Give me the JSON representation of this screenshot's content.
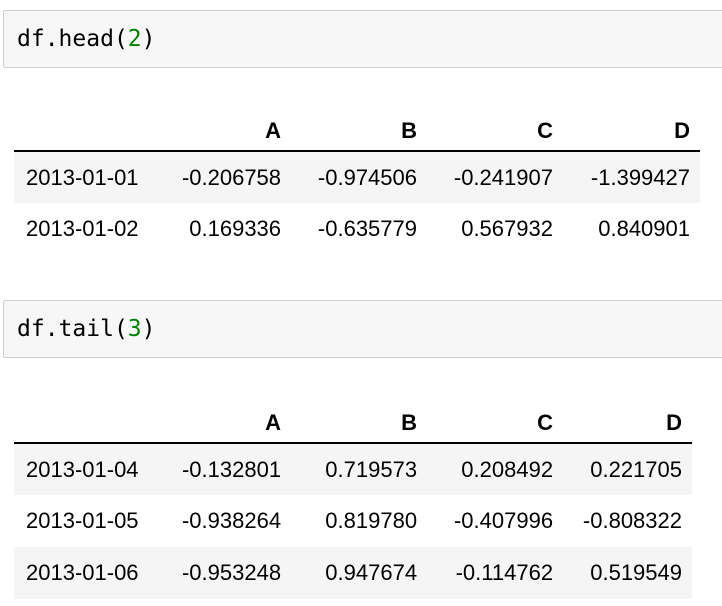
{
  "cells": [
    {
      "code_prefix": "df.head",
      "code_open": "(",
      "code_arg": "2",
      "code_close": ")",
      "table": {
        "columns": [
          "",
          "A",
          "B",
          "C",
          "D"
        ],
        "rows": [
          [
            "2013-01-01",
            "-0.206758",
            "-0.974506",
            "-0.241907",
            "-1.399427"
          ],
          [
            "2013-01-02",
            "0.169336",
            "-0.635779",
            "0.567932",
            "0.840901"
          ]
        ]
      }
    },
    {
      "code_prefix": "df.tail",
      "code_open": "(",
      "code_arg": "3",
      "code_close": ")",
      "table": {
        "columns": [
          "",
          "A",
          "B",
          "C",
          "D"
        ],
        "rows": [
          [
            "2013-01-04",
            "-0.132801",
            "0.719573",
            "0.208492",
            "0.221705"
          ],
          [
            "2013-01-05",
            "-0.938264",
            "0.819780",
            "-0.407996",
            "-0.808322"
          ],
          [
            "2013-01-06",
            "-0.953248",
            "0.947674",
            "-0.114762",
            "0.519549"
          ]
        ]
      }
    }
  ],
  "colors": {
    "code_number": "#008000",
    "cell_background": "#f7f7f7",
    "cell_border": "#cfcfcf",
    "row_stripe": "#f5f5f5"
  }
}
